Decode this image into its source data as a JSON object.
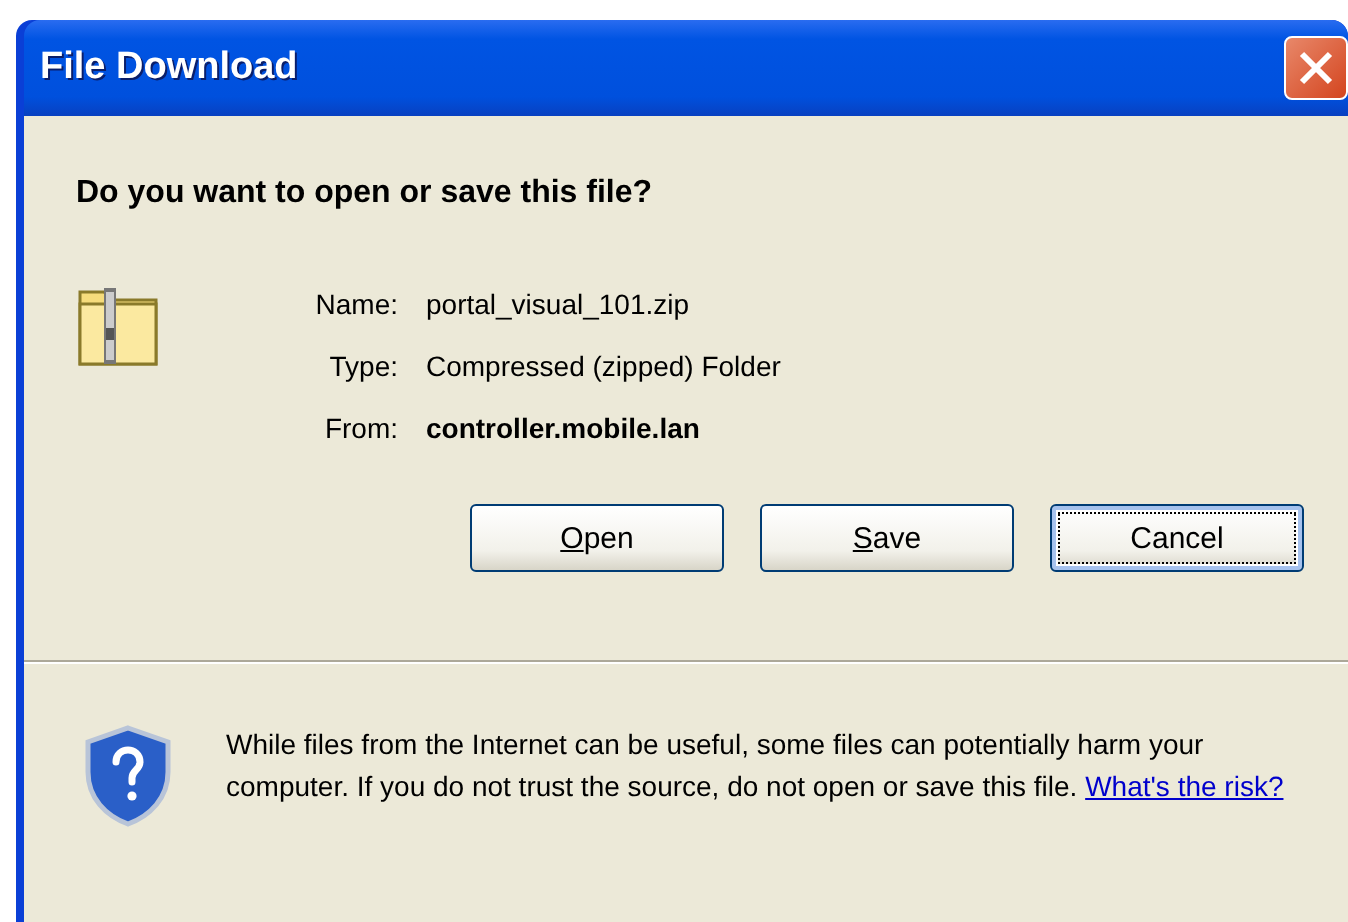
{
  "window": {
    "title": "File Download"
  },
  "question": "Do you want to open or save this file?",
  "file_info": [
    {
      "label": "Name:",
      "value": "portal_visual_101.zip",
      "bold": false
    },
    {
      "label": "Type:",
      "value": "Compressed (zipped) Folder",
      "bold": false
    },
    {
      "label": "From:",
      "value": "controller.mobile.lan",
      "bold": true
    }
  ],
  "buttons": [
    {
      "access_key": "O",
      "rest": "pen",
      "focused": false
    },
    {
      "access_key": "S",
      "rest": "ave",
      "focused": false
    },
    {
      "rest": "Cancel",
      "focused": true
    }
  ],
  "warning": {
    "text": "While files from the Internet can be useful, some files can potentially harm your computer. If you do not trust the source, do not open or save this file.",
    "link": "What's the risk?"
  }
}
